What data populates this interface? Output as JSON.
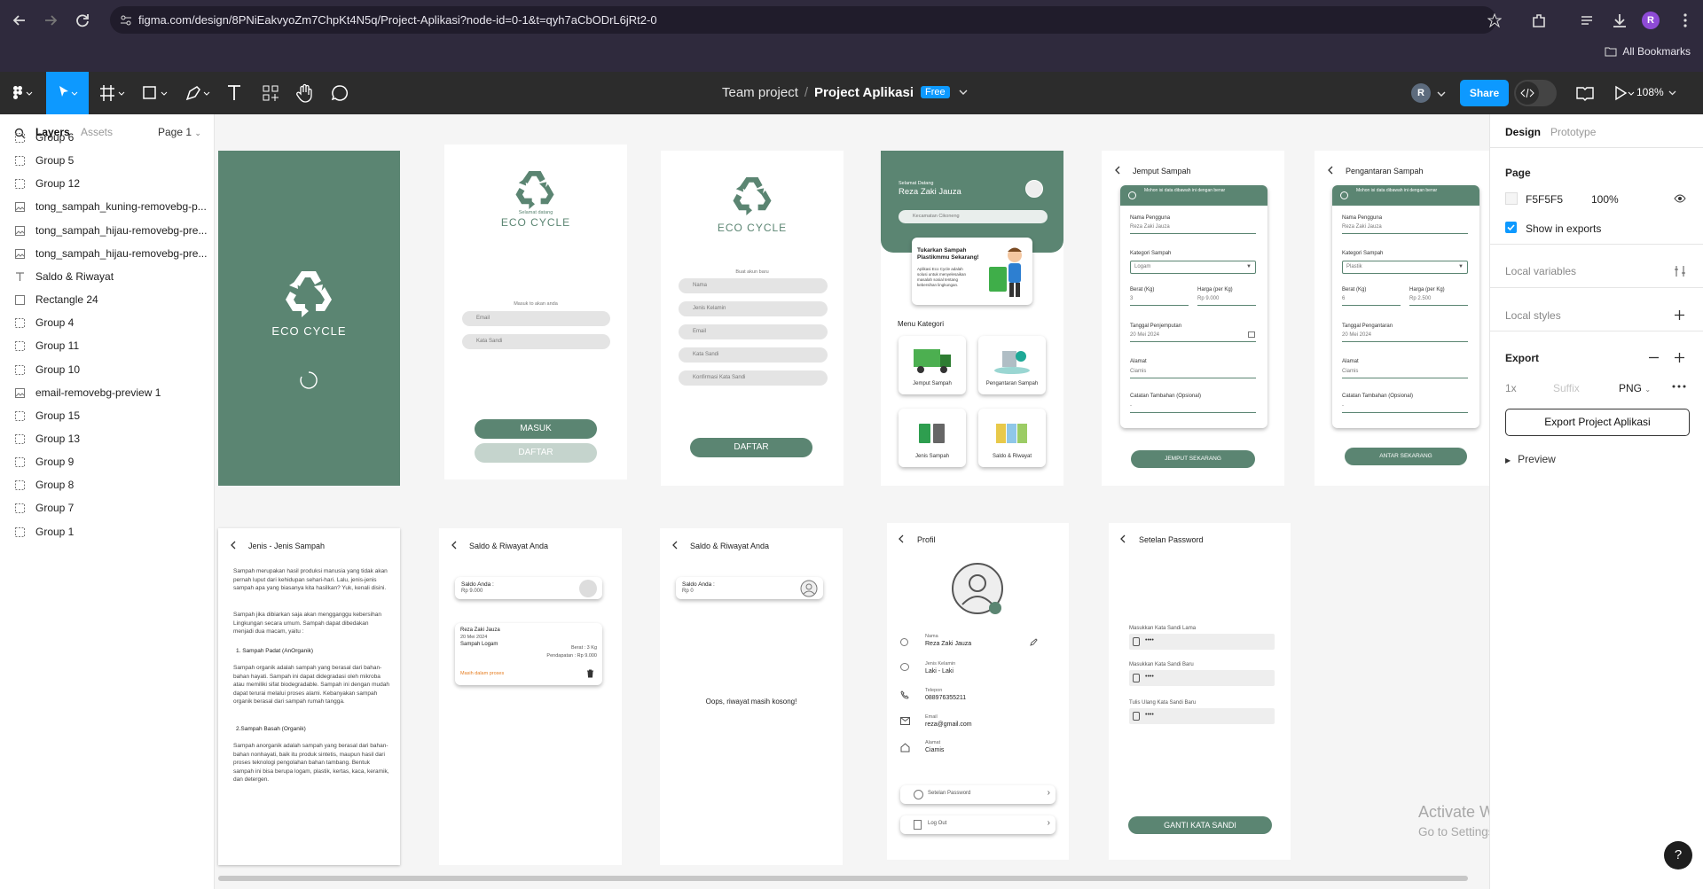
{
  "browser": {
    "url": "figma.com/design/8PNiEakvyoZm7ChpKt4N5q/Project-Aplikasi?node-id=0-1&t=qyh7aCbODrL6jRt2-0",
    "all_bookmarks": "All Bookmarks",
    "profile_initial": "R"
  },
  "toolbar": {
    "team": "Team project",
    "project": "Project Aplikasi",
    "plan_badge": "Free",
    "avatar_initial": "R",
    "share_label": "Share",
    "zoom_level": "108%"
  },
  "left_panel": {
    "tab_layers": "Layers",
    "tab_assets": "Assets",
    "page_label": "Page 1",
    "layers": [
      {
        "name": "Group 6",
        "icon": "group-icon"
      },
      {
        "name": "Group 5",
        "icon": "group-icon"
      },
      {
        "name": "Group 12",
        "icon": "group-icon"
      },
      {
        "name": "tong_sampah_kuning-removebg-p...",
        "icon": "image-icon"
      },
      {
        "name": "tong_sampah_hijau-removebg-pre...",
        "icon": "image-icon"
      },
      {
        "name": "tong_sampah_hijau-removebg-pre...",
        "icon": "image-icon"
      },
      {
        "name": "Saldo & Riwayat",
        "icon": "text-icon"
      },
      {
        "name": "Rectangle 24",
        "icon": "rectangle-icon"
      },
      {
        "name": "Group 4",
        "icon": "group-icon"
      },
      {
        "name": "Group 11",
        "icon": "group-icon"
      },
      {
        "name": "Group 10",
        "icon": "group-icon"
      },
      {
        "name": "email-removebg-preview 1",
        "icon": "image-icon"
      },
      {
        "name": "Group 15",
        "icon": "group-icon"
      },
      {
        "name": "Group 13",
        "icon": "group-icon"
      },
      {
        "name": "Group 9",
        "icon": "group-icon"
      },
      {
        "name": "Group 8",
        "icon": "group-icon"
      },
      {
        "name": "Group 7",
        "icon": "group-icon"
      },
      {
        "name": "Group 1",
        "icon": "group-icon"
      }
    ]
  },
  "right_panel": {
    "tab_design": "Design",
    "tab_prototype": "Prototype",
    "page_heading": "Page",
    "page_color": "F5F5F5",
    "page_opacity": "100%",
    "show_in_exports": "Show in exports",
    "local_variables": "Local variables",
    "local_styles": "Local styles",
    "export_heading": "Export",
    "export_scale": "1x",
    "export_suffix_placeholder": "Suffix",
    "export_format": "PNG",
    "export_button": "Export Project Aplikasi",
    "preview": "Preview"
  },
  "screens": {
    "splash": {
      "brand": "ECO CYCLE"
    },
    "login": {
      "welcome": "Selamat datang",
      "brand": "ECO CYCLE",
      "prompt": "Masuk to akan anda",
      "email": "Email",
      "password": "Kata Sandi",
      "login_btn": "MASUK",
      "register_btn": "DAFTAR"
    },
    "register": {
      "brand": "ECO CYCLE",
      "prompt": "Buat akun baru",
      "fields": [
        "Nama",
        "Jenis Kelamin",
        "Email",
        "Kata Sandi",
        "Konfirmasi Kata Sandi"
      ],
      "button": "DAFTAR"
    },
    "home": {
      "greeting": "Selamat Datang",
      "user": "Reza Zaki Jauza",
      "location": "Kecamatan Cikoneng",
      "promo_title": "Tukarkan Sampah Plastikmmu Sekarang!",
      "promo_text": "Aplikasi Eco Cycle adalah solusi untuk menyelesaikan masalah sosial tentang kebersihan lingkungan.",
      "menu_heading": "Menu Kategori",
      "menu": [
        "Jemput Sampah",
        "Pengantaran Sampah",
        "Jenis Sampah",
        "Saldo & Riwayat"
      ]
    },
    "pickup": {
      "title": "Jemput Sampah",
      "notice": "Mohon isi data dibawah ini dengan benar",
      "name_label": "Nama Pengguna",
      "name_value": "Reza Zaki Jauza",
      "cat_label": "Kategori Sampah",
      "cat_value": "Logam",
      "weight_label": "Berat (Kg)",
      "weight_value": "3",
      "price_label": "Harga (per Kg)",
      "price_value": "Rp 9.000",
      "date_label": "Tanggal Penjemputan",
      "date_value": "20 Mei 2024",
      "address_label": "Alamat",
      "address_value": "Ciamis",
      "note_label": "Catatan Tambahan (Opsional)",
      "note_value": "-",
      "button": "JEMPUT SEKARANG"
    },
    "delivery": {
      "title": "Pengantaran Sampah",
      "notice": "Mohon isi data dibawah ini dengan benar",
      "name_label": "Nama Pengguna",
      "name_value": "Reza Zaki Jauza",
      "cat_label": "Kategori Sampah",
      "cat_value": "Plastik",
      "weight_label": "Berat (Kg)",
      "weight_value": "6",
      "price_label": "Harga (per Kg)",
      "price_value": "Rp 2.500",
      "date_label": "Tanggal Pengantaran",
      "date_value": "20 Mei 2024",
      "address_label": "Alamat",
      "address_value": "Ciamis",
      "note_label": "Catatan Tambahan (Opsional)",
      "note_value": "-",
      "button": "ANTAR SEKARANG"
    },
    "types": {
      "title": "Jenis - Jenis Sampah",
      "p1": "Sampah merupakan hasil produksi manusia yang tidak akan pernah luput dari kehidupan sehari-hari. Lalu, jenis-jenis sampah apa yang biasanya kita hasilkan? Yuk, kenali disini.",
      "p2": "Sampah jika dibiarkan saja akan mengganggu kebersihan Lingkungan secara umum. Sampah dapat dibedakan menjadi dua macam, yaitu :",
      "h1": "1. Sampah Padat (AnOrganik)",
      "p3": "Sampah organik adalah sampah yang berasal dari bahan-bahan hayati. Sampah ini dapat didegradasi oleh mikroba atau memiliki sifat biodegradable. Sampah ini dengan mudah dapat terurai melalui proses alami. Kebanyakan sampah organik berasal dari sampah rumah tangga.",
      "h2": "2.Sampah Basah (Organik)",
      "p4": "Sampah anorganik adalah sampah yang berasal dari bahan-bahan nonhayati, baik itu produk sintetis, maupun hasil dari proses teknologi pengolahan bahan tambang. Bentuk sampah ini bisa berupa logam, plastik, kertas, kaca, keramik, dan detergen."
    },
    "history": {
      "title": "Saldo & Riwayat Anda",
      "balance_label": "Saldo Anda :",
      "balance": "Rp 9.000",
      "entry_name": "Reza Zaki Jauza",
      "entry_date": "20 Mei 2024",
      "entry_type": "Sampah Logam",
      "entry_weight": "Berat : 3 Kg",
      "entry_income": "Pendapatan : Rp 9.000",
      "entry_status": "Masih dalam proses"
    },
    "history_empty": {
      "title": "Saldo & Riwayat Anda",
      "balance_label": "Saldo Anda :",
      "balance": "Rp 0",
      "empty": "Oops, riwayat masih kosong!"
    },
    "profile": {
      "title": "Profil",
      "name_label": "Nama",
      "name": "Reza Zaki Jauza",
      "gender_label": "Jenis Kelamin",
      "gender": "Laki - Laki",
      "phone_label": "Telepon",
      "phone": "088976355211",
      "email_label": "Email",
      "email": "reza@gmail.com",
      "address_label": "Alamat",
      "address": "Ciamis",
      "password_settings": "Setelan Password",
      "logout": "Log Out"
    },
    "password": {
      "title": "Setelan Password",
      "old_label": "Masukkan Kata Sandi Lama",
      "new_label": "Masukkan Kata Sandi Baru",
      "repeat_label": "Tulis Ulang Kata Sandi Baru",
      "masked": "••••",
      "button": "GANTI KATA SANDI"
    }
  },
  "watermark": {
    "line1": "Activate Windows",
    "line2": "Go to Settings to activate Windows."
  },
  "help": "?",
  "colors": {
    "brand_green": "#5b8572",
    "figma_blue": "#0d99ff"
  }
}
